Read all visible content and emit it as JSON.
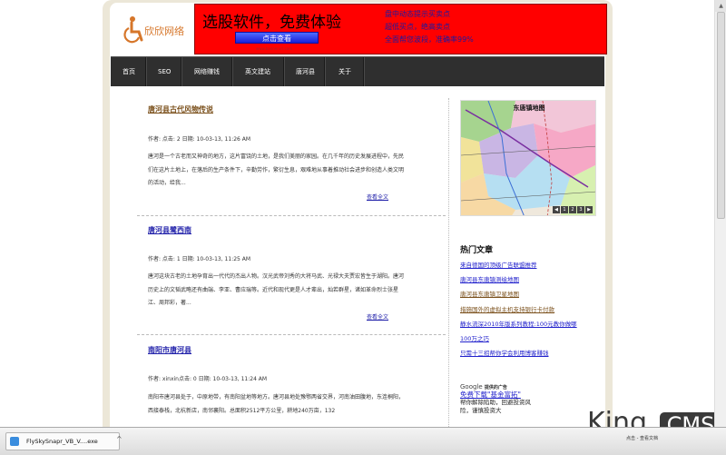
{
  "site": {
    "name": "欣欣网络"
  },
  "banner": {
    "title": "选股软件，免费体验",
    "button": "点击查看",
    "url": "www.bannerurl.com",
    "lines": [
      "盘中动态提示买卖点",
      "超低买点，绝高卖点",
      "全面帮您波段，准确率99%"
    ]
  },
  "nav": {
    "items": [
      "首页",
      "SEO",
      "网络赚钱",
      "英文建站",
      "唐河县",
      "关于"
    ]
  },
  "articles": [
    {
      "title": "唐河县古代风物传说",
      "meta": "作者: 点击: 2 日期: 10-03-13, 11:26 AM",
      "body": "唐河是一个古老而又神奇的地方，这片富饶的土地，是我们美丽的家园。在几千年的历史发展进程中，先民们在这片土地上，在落后的生产条件下，辛勤劳作，繁衍生息，艰难地从事着推动社会进步和创造人类文明的活动，给我...",
      "more": "查看全文"
    },
    {
      "title": "唐河县鹭西南",
      "meta": "作者: 点击: 1 日期: 10-03-13, 11:25 AM",
      "body": "唐河这块古老的土地孕育出一代代的杰出人物。汉光武帝刘秀的大将马武、光禄大夫贾宏皆生于湖阳。唐河历史上的文韬武略还有曲端、李亚、曹应瑞等。近代和现代更是人才辈出，灿若群星，诸如革命烈士张星江、周邦彩，著...",
      "more": "查看全文"
    },
    {
      "title": "南阳市唐河县",
      "meta": "作者: xinxin点击: 0 日期: 10-03-13, 11:24 AM",
      "body": "南阳市唐河县处于，中原地带，有南阳盆地等地方。唐河县地处豫鄂两省交界，河南油田腹地，东连桐阳，西接泰栈，北杭新店，南邻襄阳。总面积2512平方公里，耕地240万亩，132"
    }
  ],
  "sidebar": {
    "map_title": "东唐镇地图",
    "map_nav": [
      "◀",
      "1",
      "2",
      "3",
      "▶"
    ],
    "hot_title": "热门文章",
    "hot_items": [
      "来自德国的顶级广告联盟推荐",
      "唐河县东唐镇测绘地图",
      "唐河县东唐镇卫星地图",
      "措施国外的虚拟主机支持银行卡付款",
      "静水流深2010年版系列教程:100元教你做哪",
      "100万之巧",
      "只需十三招帮你学会利用博客赚钱"
    ],
    "ad_google_prefix": "Google",
    "ad_google_suffix": "提供的广告",
    "ad_link": "免费下载\"基金富拓\"",
    "ad_text": "帮你解除陷助，回避投资风险，谨慎投资大"
  },
  "watermark": {
    "king": "King",
    "cms": "CMS"
  },
  "taskbar": {
    "item": "FlySkySnapr_VB_V....exe",
    "tray": "点击 - 查看文档"
  },
  "colors": {
    "banner_red": "#ff0000",
    "nav_bg": "#2f2f2f",
    "link_blue": "#2222aa",
    "title_brown": "#7a4f1a"
  }
}
